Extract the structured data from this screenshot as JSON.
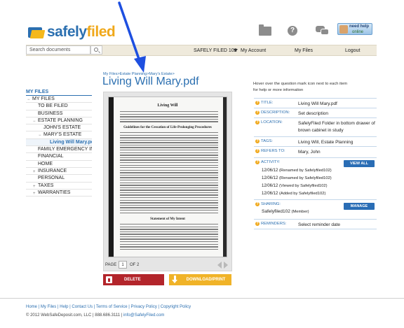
{
  "header": {
    "logo_part1": "safely",
    "logo_part2": "filed",
    "need_help_line1": "need help",
    "need_help_line2": "online",
    "icons": [
      "folder-icon",
      "help-icon",
      "chat-icon"
    ]
  },
  "nav": {
    "search_placeholder": "Search documents",
    "account_name": "SAFELY FILED 102",
    "my_account": "My Account",
    "my_files": "My Files",
    "logout": "Logout"
  },
  "sidebar": {
    "title": "MY FILES",
    "items": [
      {
        "label": "MY FILES",
        "toggle": "−"
      },
      {
        "label": "TO BE FILED",
        "toggle": ""
      },
      {
        "label": "BUSINESS",
        "toggle": ""
      },
      {
        "label": "ESTATE PLANNING",
        "toggle": "−"
      },
      {
        "label": "JOHN'S ESTATE",
        "toggle": ""
      },
      {
        "label": "MARY'S ESTATE",
        "toggle": "−"
      },
      {
        "label": "Living Will Mary.pdf",
        "toggle": ""
      },
      {
        "label": "FAMILY EMERGENCY INFO",
        "toggle": ""
      },
      {
        "label": "FINANCIAL",
        "toggle": ""
      },
      {
        "label": "HOME",
        "toggle": ""
      },
      {
        "label": "INSURANCE",
        "toggle": "+"
      },
      {
        "label": "PERSONAL",
        "toggle": ""
      },
      {
        "label": "TAXES",
        "toggle": "+"
      },
      {
        "label": "WARRANTIES",
        "toggle": "+"
      }
    ]
  },
  "main": {
    "breadcrumb": "My Files>Estate Planning>Mary's Estate>",
    "title": "Living Will Mary.pdf",
    "doc": {
      "heading": "Living Will",
      "section1": "Guidelines for the Cessation of Life-Prolonging Procedures",
      "section2": "Statement of My Intent"
    },
    "pager": {
      "page_label": "PAGE",
      "page_num": "1",
      "of_label": "OF 2"
    },
    "delete_label": "DELETE",
    "download_label": "DOWNLOAD/PRINT"
  },
  "details": {
    "hint": "Hover over the question mark icon next to each item for help or more information",
    "title_label": "TITLE:",
    "title_value": "Living Will Mary.pdf",
    "desc_label": "DESCRIPTION:",
    "desc_value": "Set description",
    "loc_label": "LOCATION:",
    "loc_value": "SafelyFiled Folder in bottom drawer of brown cabinet in study",
    "tags_label": "TAGS:",
    "tags_value": "Living Will, Estate Planning",
    "refers_label": "REFERS TO:",
    "refers_value": "Mary, John",
    "activity_label": "ACTIVITY:",
    "view_all": "VIEW ALL",
    "activity": [
      {
        "date": "12/06/12",
        "text": "(Renamed by Safelyfiled102)"
      },
      {
        "date": "12/06/12",
        "text": "(Renamed by Safelyfiled102)"
      },
      {
        "date": "12/06/12",
        "text": "(Viewed by Safelyfiled102)"
      },
      {
        "date": "12/06/12",
        "text": "(Added by Safelyfiled102)"
      }
    ],
    "sharing_label": "SHARING:",
    "manage": "MANAGE",
    "sharing_user": "Safelyfiled102",
    "sharing_role": "(Member)",
    "reminders_label": "REMINDERS:",
    "reminders_value": "Select reminder date"
  },
  "footer": {
    "links": [
      "Home",
      "My Files",
      "Help",
      "Contact Us",
      "Terms of Service",
      "Privacy Policy",
      "Copyright Policy"
    ],
    "copyright": "© 2012 WebSafeDeposit.com, LLC | 888.686.3111 | ",
    "email": "info@SafelyFiled.com"
  },
  "colors": {
    "brand_blue": "#2b6fb0",
    "brand_orange": "#f0a81a",
    "delete_red": "#b3252b",
    "download_yellow": "#f0b328",
    "annotation_arrow": "#1e4fe0"
  }
}
